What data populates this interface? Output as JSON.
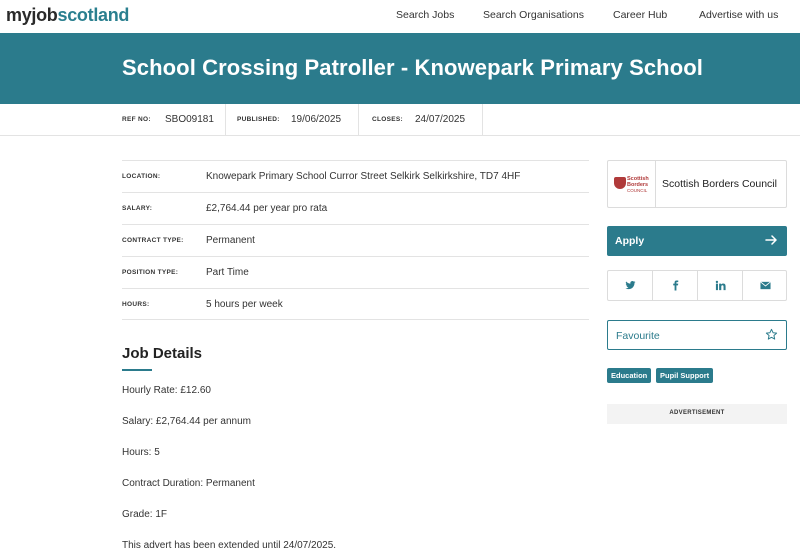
{
  "brand": {
    "part1": "myjob",
    "part2": "scotland"
  },
  "nav": {
    "links": [
      "Search Jobs",
      "Search Organisations",
      "Career Hub",
      "Advertise with us"
    ]
  },
  "job": {
    "title": "School Crossing Patroller - Knowepark Primary School"
  },
  "refbar": {
    "ref_label": "REF NO:",
    "ref_value": "SBO09181",
    "published_label": "PUBLISHED:",
    "published_value": "19/06/2025",
    "closes_label": "CLOSES:",
    "closes_value": "24/07/2025"
  },
  "info": [
    {
      "label": "LOCATION:",
      "value": "Knowepark Primary School Curror Street Selkirk Selkirkshire, TD7 4HF"
    },
    {
      "label": "SALARY:",
      "value": "£2,764.44 per year pro rata"
    },
    {
      "label": "CONTRACT TYPE:",
      "value": "Permanent"
    },
    {
      "label": "POSITION TYPE:",
      "value": "Part Time"
    },
    {
      "label": "HOURS:",
      "value": "5 hours per week"
    }
  ],
  "details": {
    "heading": "Job Details",
    "lines": [
      "Hourly Rate: £12.60",
      "Salary: £2,764.44 per annum",
      "Hours: 5",
      "Contract Duration: Permanent",
      "Grade: 1F",
      "This advert has been extended until 24/07/2025."
    ]
  },
  "employer": {
    "logo_text": [
      "Scottish",
      "Borders",
      "COUNCIL"
    ],
    "name": "Scottish Borders Council"
  },
  "apply": {
    "label": "Apply",
    "icon": "arrow-right-icon"
  },
  "share": {
    "icons": [
      "twitter-icon",
      "facebook-icon",
      "linkedin-icon",
      "email-icon"
    ]
  },
  "favourite": {
    "label": "Favourite",
    "icon": "star-icon"
  },
  "tags": [
    "Education",
    "Pupil Support"
  ],
  "advert": {
    "label": "ADVERTISEMENT"
  },
  "colors": {
    "brand_teal": "#2b7b8c",
    "text": "#222222"
  }
}
